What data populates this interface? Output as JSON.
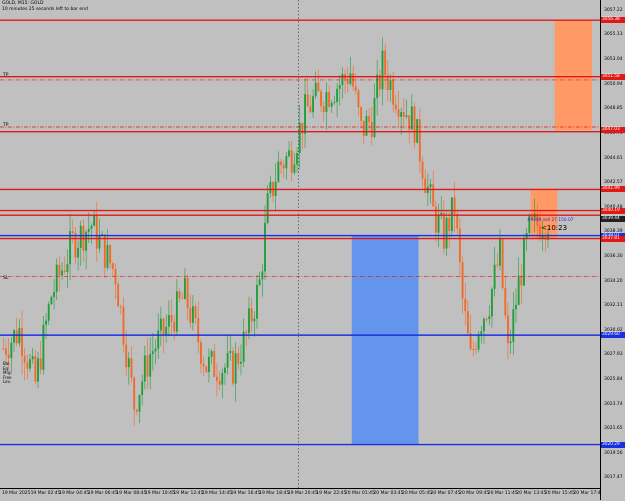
{
  "header": {
    "symbol_line": "GOLD, M15: GOLD",
    "timer_line": "10 minutes 25 seconds left to bar end"
  },
  "countdown": "<10:23",
  "alert_label": "#9089 sell 27.150.07",
  "line_labels": {
    "tp_1": "TP",
    "tp_2": "TP",
    "sl": "SL"
  },
  "side_labels": [
    "Bal.",
    "Eq.",
    "Mrg.",
    "Free",
    "Lev."
  ],
  "price_axis": {
    "ticks": [
      "3057.22",
      "3055.13",
      "3053.04",
      "3050.94",
      "3048.85",
      "3046.76",
      "3044.61",
      "3042.57",
      "3040.48",
      "3038.39",
      "3036.30",
      "3034.20",
      "3032.11",
      "3030.02",
      "3027.93",
      "3025.84",
      "3023.74",
      "3021.65",
      "3019.56",
      "3017.47"
    ],
    "tags": [
      {
        "label": "3056.38",
        "kind": "red"
      },
      {
        "label": "3051.58",
        "kind": "red"
      },
      {
        "label": "3047.03",
        "kind": "red"
      },
      {
        "label": "3041.99",
        "kind": "red"
      },
      {
        "label": "3040.19",
        "kind": "red"
      },
      {
        "label": "3039.44",
        "kind": "dark"
      },
      {
        "label": "3038.07",
        "kind": "blue"
      },
      {
        "label": "3037.81",
        "kind": "red"
      },
      {
        "label": "3029.60",
        "kind": "blue"
      },
      {
        "label": "3020.29",
        "kind": "blue"
      }
    ]
  },
  "time_axis": {
    "ticks": [
      "19 Mar 2025",
      "19 Mar 02:45",
      "19 Mar 04:45",
      "19 Mar 06:45",
      "19 Mar 08:45",
      "19 Mar 10:45",
      "19 Mar 12:45",
      "19 Mar 14:45",
      "19 Mar 16:45",
      "19 Mar 18:45",
      "19 Mar 20:45",
      "19 Mar 22:45",
      "20 Mar 01:45",
      "20 Mar 03:45",
      "20 Mar 05:45",
      "20 Mar 07:45",
      "20 Mar 09:45",
      "20 Mar 11:45",
      "20 Mar 13:45",
      "20 Mar 15:45",
      "20 Mar 17:45"
    ]
  },
  "colors": {
    "background": "#c0c0c0",
    "bull_candle": "#1f9e3a",
    "bear_candle": "#f06a28",
    "red_level": "#e01818",
    "blue_level": "#1a2fe0",
    "blue_zone": "#6495ed",
    "salmon_zone": "#ff9966"
  },
  "chart_data": {
    "type": "candlestick",
    "ylim": [
      3016.6,
      3058.1
    ],
    "levels": [
      {
        "price": 3056.38,
        "color": "red",
        "style": "solid"
      },
      {
        "price": 3051.58,
        "color": "red",
        "style": "solid"
      },
      {
        "price": 3051.3,
        "color": "red",
        "style": "dashdot"
      },
      {
        "price": 3047.3,
        "color": "red",
        "style": "dashdot"
      },
      {
        "price": 3046.9,
        "color": "red",
        "style": "solid"
      },
      {
        "price": 3041.99,
        "color": "red",
        "style": "solid"
      },
      {
        "price": 3040.19,
        "color": "red",
        "style": "solid"
      },
      {
        "price": 3039.8,
        "color": "red",
        "style": "solid"
      },
      {
        "price": 3038.07,
        "color": "blue",
        "style": "solid"
      },
      {
        "price": 3037.81,
        "color": "red",
        "style": "solid"
      },
      {
        "price": 3034.6,
        "color": "red",
        "style": "dashdot"
      },
      {
        "price": 3029.6,
        "color": "blue",
        "style": "solid"
      },
      {
        "price": 3020.29,
        "color": "blue",
        "style": "solid"
      }
    ],
    "zones": [
      {
        "price_top": 3038.07,
        "price_bottom": 3020.29,
        "bar_start": 131,
        "bar_end": 156,
        "color": "blue"
      },
      {
        "price_top": 3056.38,
        "price_bottom": 3047.03,
        "bar_start": 207,
        "bar_end": 221,
        "color": "salmon"
      },
      {
        "price_top": 3041.99,
        "price_bottom": 3037.81,
        "bar_start": 198,
        "bar_end": 208,
        "color": "salmon"
      }
    ],
    "session_separator_bar": 111,
    "anchors": [
      [
        0,
        3028.5
      ],
      [
        6,
        3030.0
      ],
      [
        12,
        3025.5
      ],
      [
        18,
        3033.0
      ],
      [
        26,
        3037.5
      ],
      [
        33,
        3039.0
      ],
      [
        42,
        3034.8
      ],
      [
        49,
        3023.7
      ],
      [
        55,
        3028.0
      ],
      [
        62,
        3030.5
      ],
      [
        68,
        3033.0
      ],
      [
        76,
        3027.0
      ],
      [
        86,
        3026.8
      ],
      [
        91,
        3029.5
      ],
      [
        96,
        3034.0
      ],
      [
        99,
        3040.5
      ],
      [
        103,
        3044.0
      ],
      [
        108,
        3045.0
      ],
      [
        113,
        3048.5
      ],
      [
        116,
        3049.5
      ],
      [
        120,
        3050.0
      ],
      [
        126,
        3051.0
      ],
      [
        130,
        3052.0
      ],
      [
        134,
        3047.0
      ],
      [
        138,
        3048.0
      ],
      [
        142,
        3052.5
      ],
      [
        146,
        3050.5
      ],
      [
        150,
        3049.0
      ],
      [
        154,
        3047.5
      ],
      [
        158,
        3043.0
      ],
      [
        161,
        3040.0
      ],
      [
        165,
        3038.0
      ],
      [
        169,
        3040.5
      ],
      [
        172,
        3032.5
      ],
      [
        175,
        3027.5
      ],
      [
        178,
        3030.5
      ],
      [
        182,
        3032.5
      ],
      [
        186,
        3036.5
      ],
      [
        189,
        3028.0
      ],
      [
        193,
        3034.0
      ],
      [
        197,
        3038.5
      ],
      [
        200,
        3039.0
      ],
      [
        204,
        3039.4
      ]
    ],
    "total_bars": 205
  }
}
